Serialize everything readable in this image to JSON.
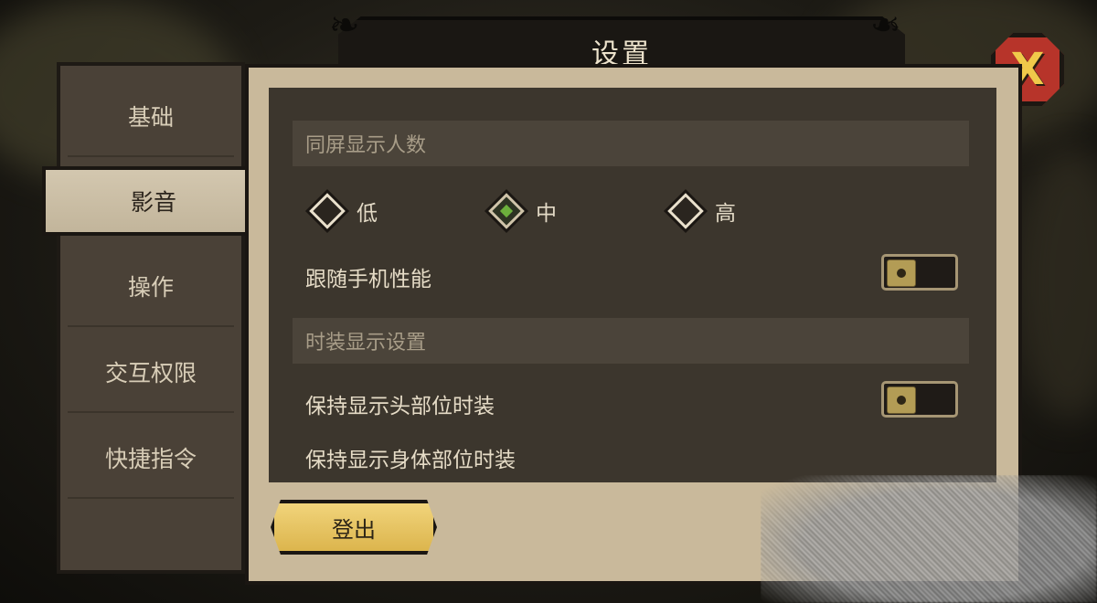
{
  "window": {
    "title": "设置"
  },
  "close_button": {
    "icon": "close-x-icon",
    "color": "#b7342a",
    "glyph": "X"
  },
  "sidebar": {
    "items": [
      {
        "label": "基础",
        "active": false
      },
      {
        "label": "影音",
        "active": true
      },
      {
        "label": "操作",
        "active": false
      },
      {
        "label": "交互权限",
        "active": false
      },
      {
        "label": "快捷指令",
        "active": false
      }
    ]
  },
  "sections": [
    {
      "header": "同屏显示人数",
      "options": [
        {
          "label": "低",
          "selected": false
        },
        {
          "label": "中",
          "selected": true
        },
        {
          "label": "高",
          "selected": false
        }
      ],
      "toggle_rows": [
        {
          "label": "跟随手机性能",
          "on": false
        }
      ]
    },
    {
      "header": "时装显示设置",
      "toggle_rows": [
        {
          "label": "保持显示头部位时装",
          "on": false
        }
      ],
      "extra_rows": [
        {
          "label": "保持显示身体部位时装"
        }
      ]
    }
  ],
  "logout_button": {
    "label": "登出",
    "color": "#e6c25f"
  },
  "colors": {
    "accent_selected": "#6cb03c",
    "panel": "#3c362d",
    "frame": "#c9b99b"
  }
}
